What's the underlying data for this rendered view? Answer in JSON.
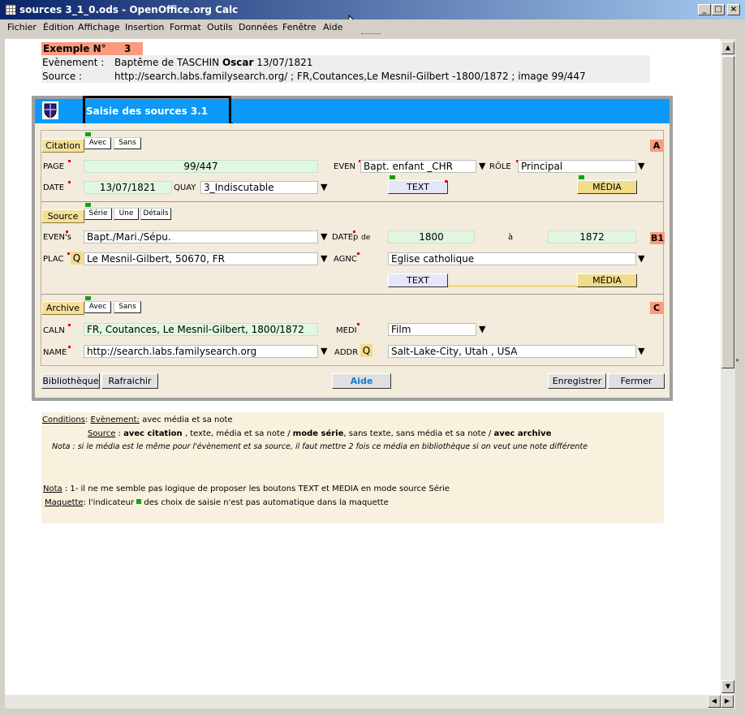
{
  "window": {
    "title": "sources 3_1_0.ods - OpenOffice.org Calc",
    "minimize": "_",
    "maximize": "□",
    "close": "×"
  },
  "menu": {
    "items": [
      "Fichier",
      "Édition",
      "Affichage",
      "Insertion",
      "Format",
      "Outils",
      "Données",
      "Fenêtre",
      "Aide"
    ]
  },
  "header": {
    "example_label": "Exemple N°",
    "example_number": "3",
    "event_label": "Evènement :",
    "event_text_before": "Baptême de TASCHIN ",
    "event_text_bold": "Oscar",
    "event_text_after": " 13/07/1821",
    "source_label": "Source :",
    "source_text": "http://search.labs.familysearch.org/ ; FR,Coutances,Le Mesnil-Gilbert -1800/1872 ; image 99/447"
  },
  "form": {
    "title": "Saisie des sources 3.1",
    "citation": {
      "tab": "Citation",
      "opt_avec": "Avec",
      "opt_sans": "Sans",
      "tag": "A",
      "page_label": "PAGE",
      "page_value": "99/447",
      "even_label": "EVEN",
      "even_value": "Bapt. enfant _CHR",
      "role_label": "RÔLE",
      "role_value": "Principal",
      "date_label": "DATE",
      "date_value": "13/07/1821",
      "quay_label": "QUAY",
      "quay_value": "3_Indiscutable",
      "text_btn": "TEXT",
      "media_btn": "MÉDIA"
    },
    "source": {
      "tab": "Source",
      "opt_serie": "Série",
      "opt_une": "Une",
      "opt_details": "Détails",
      "tag": "B1",
      "evens_label": "EVEN's",
      "evens_value": "Bapt./Mari./Sépu.",
      "datep_label": "DATEp",
      "de_label": "de",
      "date_from": "1800",
      "a_label": "à",
      "date_to": "1872",
      "plac_label": "PLAC",
      "q_label": "Q",
      "plac_value": "Le Mesnil-Gilbert, 50670, FR",
      "agnc_label": "AGNC",
      "agnc_value": "Eglise catholique",
      "text_btn": "TEXT",
      "media_btn": "MÉDIA"
    },
    "archive": {
      "tab": "Archive",
      "opt_avec": "Avec",
      "opt_sans": "Sans",
      "tag": "C",
      "caln_label": "CALN",
      "caln_value": "FR, Coutances, Le Mesnil-Gilbert, 1800/1872",
      "medi_label": "MEDI",
      "medi_value": "Film",
      "name_label": "NAME",
      "name_value": "http://search.labs.familysearch.org",
      "addr_label": "ADDR",
      "q_label": "Q",
      "addr_value": "Salt-Lake-City, Utah , USA"
    },
    "buttons": {
      "bibliotheque": "Bibliothèque",
      "rafraichir": "Rafraichir",
      "aide": "Aide",
      "enregistrer": "Enregistrer",
      "fermer": "Fermer"
    }
  },
  "notes": {
    "conditions_label": "Conditions",
    "colon": ":",
    "evenement_label": "Evènement:",
    "evenement_text": " avec média et sa note",
    "source_label": "Source",
    "source_sep": " : ",
    "source_bold1": "avec citation",
    "source_t1": " , texte, média et sa note / ",
    "source_bold2": "mode série",
    "source_t2": ", sans texte, sans média et sa note / ",
    "source_bold3": "avec archive",
    "nota_italic": "Nota : si le média est le même pour l'évènement et sa source, il faut mettre 2 fois ce média en bibliothèque si on veut une note différente",
    "nota_label": "Nota",
    "nota_text": " : 1- il ne me semble pas logique de proposer les boutons TEXT et MEDIA en mode source Série",
    "maquette_label": "Maquette",
    "maquette_text1": ": l'indicateur ",
    "maquette_text2": " des choix de saisie n'est pas automatique dans la maquette"
  },
  "colors": {
    "title_bar": "#0a246a",
    "form_header": "#0c99f7",
    "form_body": "#f3ecdc",
    "tab_button": "#f5e09a",
    "section_tag": "#fb9b7d",
    "mint_field": "#e1f7e1",
    "indicator": "#16a016"
  },
  "icons": {
    "app": "spreadsheet-icon",
    "form": "shield-icon",
    "dropdown": "triangle-down-icon"
  }
}
